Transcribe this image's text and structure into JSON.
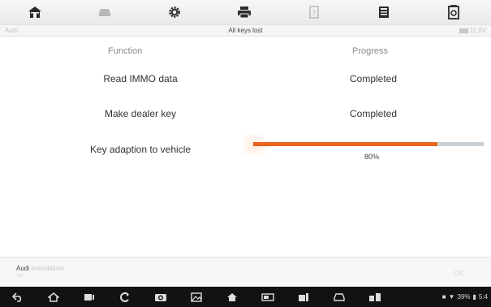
{
  "toolbar": {
    "icons": [
      "home-icon",
      "vehicle-icon",
      "settings-icon",
      "print-icon",
      "help-icon",
      "save-icon",
      "datalog-icon"
    ]
  },
  "status": {
    "left": "Audi",
    "title": "All keys lost",
    "battery": "11.8V"
  },
  "table": {
    "header_function": "Function",
    "header_progress": "Progress",
    "rows": [
      {
        "function": "Read IMMO data",
        "progress": "Completed"
      },
      {
        "function": "Make dealer key",
        "progress": "Completed"
      },
      {
        "function": "Key adaption to vehicle",
        "progress_percent": 80,
        "progress_label": "80%"
      }
    ]
  },
  "infobar": {
    "vehicle": "Audi",
    "vehicle_sub": "Immobilizer",
    "vin": "Vin",
    "button": "OK"
  },
  "system": {
    "battery_pct": "39%",
    "time": "5:4"
  },
  "colors": {
    "accent": "#e8631f",
    "toolbar_icon": "#2b2b2b",
    "nav_bg": "#121212"
  }
}
